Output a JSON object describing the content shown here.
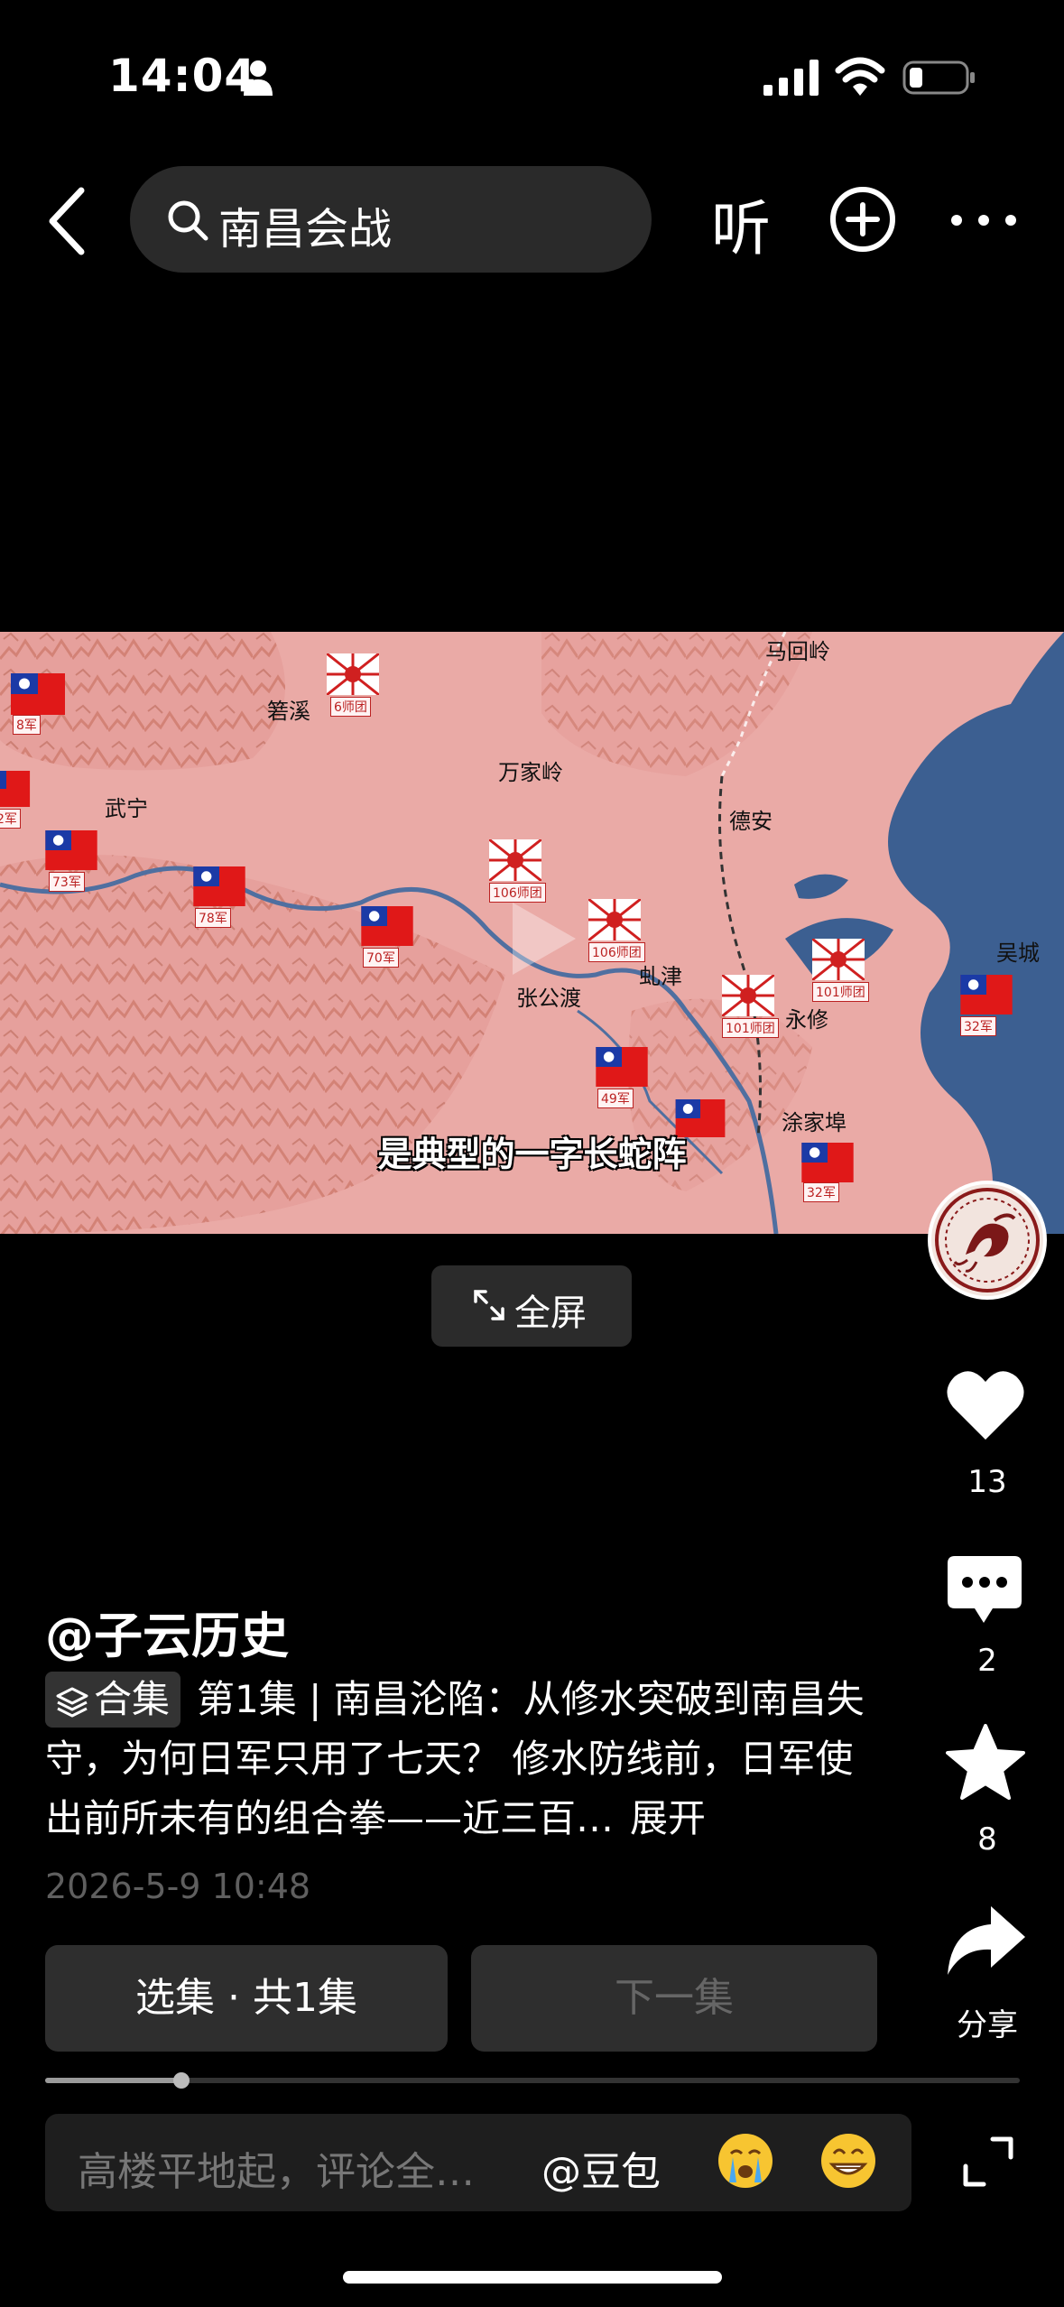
{
  "status": {
    "time": "14:04"
  },
  "search": {
    "query": "南昌会战"
  },
  "topbar": {
    "listen_label": "听"
  },
  "video": {
    "subtitle": "是典型的一字长蛇阵",
    "places": [
      "马回岭",
      "箬溪",
      "万家岭",
      "武宁",
      "德安",
      "张公渡",
      "虬津",
      "永修",
      "吴城",
      "涂家埠"
    ],
    "units": [
      "8军",
      "6师团",
      "2军",
      "73军",
      "78军",
      "106师团",
      "70军",
      "106师团",
      "101师团",
      "101师团",
      "32军",
      "49军",
      "32军"
    ]
  },
  "fullscreen": {
    "label": "全屏"
  },
  "rail": {
    "likes": "13",
    "comments": "2",
    "favorites": "8",
    "share": "分享"
  },
  "post": {
    "author": "@子云历史",
    "collection_label": "合集",
    "description": "第1集 | 南昌沦陷：从修水突破到南昌失守，为何日军只用了七天？ 修水防线前，日军使出前所未有的组合拳——近三百…",
    "expand_label": "展开",
    "date": "2026-5-9 10:48"
  },
  "episodes": {
    "select_label": "选集 · 共1集",
    "next_label": "下一集"
  },
  "playback": {
    "progress": 0.14
  },
  "comment": {
    "placeholder": "高楼平地起，评论全…",
    "mention": "@豆包"
  }
}
